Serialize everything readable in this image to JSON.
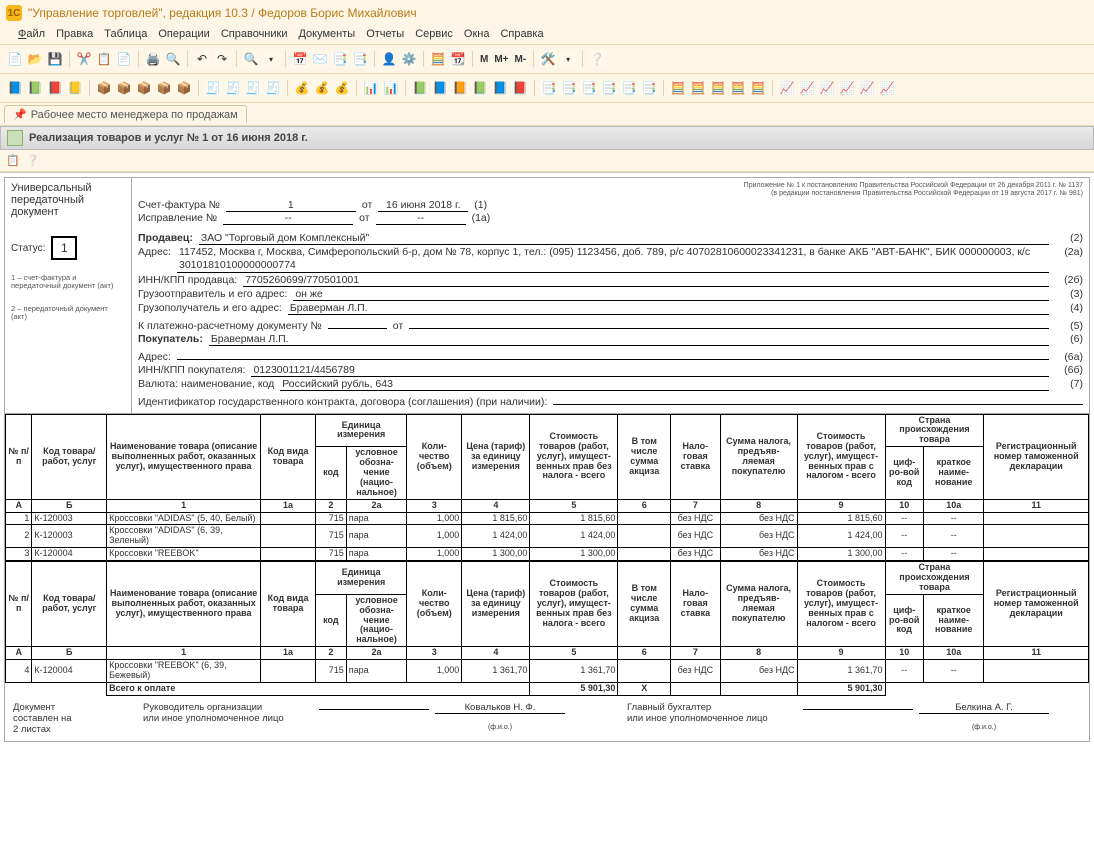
{
  "app": {
    "title": "\"Управление торговлей\", редакция 10.3 / Федоров Борис Михайлович"
  },
  "menu": {
    "file": "Файл",
    "edit": "Правка",
    "table": "Таблица",
    "ops": "Операции",
    "refs": "Справочники",
    "docs": "Документы",
    "reports": "Отчеты",
    "service": "Сервис",
    "windows": "Окна",
    "help": "Справка"
  },
  "toolbar2_labels": {
    "m": "M",
    "mplus": "M+",
    "mminus": "M-"
  },
  "tab": {
    "workspace": "Рабочее место менеджера по продажам"
  },
  "section": {
    "title": "Реализация товаров и услуг № 1 от 16 июня 2018 г."
  },
  "upd_left": {
    "line1": "Универсальный",
    "line2": "передаточный",
    "line3": "документ",
    "status_lbl": "Статус:",
    "status_val": "1",
    "foot1": "1 – счет-фактура и передаточный документ (акт)",
    "foot2": "2 – передаточный документ (акт)"
  },
  "reg_note": {
    "l1": "Приложение № 1 к постановлению Правительства Российской Федерации от 26 декабря 2011 г. № 1137",
    "l2": "(в редакции постановления Правительства Российской Федерации от 19 августа 2017 г. № 981)"
  },
  "invoice": {
    "sf_lbl": "Счет-фактура №",
    "sf_no": "1",
    "sf_ot": "от",
    "sf_date": "16 июня 2018 г.",
    "sf_code": "(1)",
    "isp_lbl": "Исправление №",
    "isp_no": "--",
    "isp_ot": "от",
    "isp_date": "--",
    "isp_code": "(1а)"
  },
  "fields": {
    "seller_lbl": "Продавец:",
    "seller_val": "ЗАО \"Торговый дом Комплексный\"",
    "seller_code": "(2)",
    "addr_lbl": "Адрес:",
    "addr_val": "117452, Москва г, Москва, Симферопольский б-р, дом № 78, корпус 1, тел.: (095) 1123456, доб. 789, р/с 40702810600023341231, в банке АКБ \"АВТ-БАНК\", БИК 000000003, к/с 30101810100000000774",
    "addr_code": "(2а)",
    "inn_s_lbl": "ИНН/КПП продавца:",
    "inn_s_val": "7705260699/770501001",
    "inn_s_code": "(2б)",
    "ship_from_lbl": "Грузоотправитель и его адрес:",
    "ship_from_val": "он же",
    "ship_from_code": "(3)",
    "ship_to_lbl": "Грузополучатель и его адрес:",
    "ship_to_val": "Браверман Л.П.",
    "ship_to_code": "(4)",
    "paydoc_lbl": "К платежно-расчетному документу №",
    "paydoc_val": "",
    "paydoc_ot": "от",
    "paydoc_code": "(5)",
    "buyer_lbl": "Покупатель:",
    "buyer_val": "Браверман Л.П.",
    "buyer_code": "(6)",
    "baddr_lbl": "Адрес:",
    "baddr_val": "",
    "baddr_code": "(6а)",
    "inn_b_lbl": "ИНН/КПП покупателя:",
    "inn_b_val": "0123001121/4456789",
    "inn_b_code": "(6б)",
    "curr_lbl": "Валюта: наименование, код",
    "curr_val": "Российский рубль, 643",
    "curr_code": "(7)",
    "gov_lbl": "Идентификатор государственного контракта, договора (соглашения) (при наличии):"
  },
  "thead": {
    "c1": "№ п/п",
    "c2": "Код товара/ работ, услуг",
    "c3": "Наименование товара (описание выполненных работ, оказанных услуг), имущественного права",
    "c4": "Код вида товара",
    "c5_top": "Единица измерения",
    "c5a": "код",
    "c5b": "условное обозна-чение (нацио-нальное)",
    "c6": "Коли-чество (объем)",
    "c7": "Цена (тариф) за единицу измерения",
    "c8": "Стоимость товаров (работ, услуг), имущест-венных прав без налога - всего",
    "c9": "В том числе сумма акциза",
    "c10": "Нало-говая ставка",
    "c11": "Сумма налога, предъяв-ляемая покупателю",
    "c12": "Стоимость товаров (работ, услуг), имущест-венных прав с налогом - всего",
    "c13_top": "Страна происхождения товара",
    "c13a": "циф-ро-вой код",
    "c13b": "краткое наиме-нование",
    "c14": "Регистрационный номер таможенной декларации",
    "rA": "А",
    "rB": "Б",
    "r1": "1",
    "r1a": "1а",
    "r2": "2",
    "r2a": "2а",
    "r3": "3",
    "r4": "4",
    "r5": "5",
    "r6": "6",
    "r7": "7",
    "r8": "8",
    "r9": "9",
    "r10": "10",
    "r10a": "10а",
    "r11": "11"
  },
  "rows1": [
    {
      "n": "1",
      "code": "К-120003",
      "name": "Кроссовки \"ADIDAS\" (5, 40, Белый)",
      "kind": "",
      "ucode": "715",
      "uname": "пара",
      "qty": "1,000",
      "price": "1 815,60",
      "sum_wo": "1 815,60",
      "excise": "",
      "rate": "без НДС",
      "tax": "без НДС",
      "sum_w": "1 815,60",
      "cc": "--",
      "cn": "--",
      "decl": ""
    },
    {
      "n": "2",
      "code": "К-120003",
      "name": "Кроссовки \"ADIDAS\" (6, 39, Зеленый)",
      "kind": "",
      "ucode": "715",
      "uname": "пара",
      "qty": "1,000",
      "price": "1 424,00",
      "sum_wo": "1 424,00",
      "excise": "",
      "rate": "без НДС",
      "tax": "без НДС",
      "sum_w": "1 424,00",
      "cc": "--",
      "cn": "--",
      "decl": ""
    },
    {
      "n": "3",
      "code": "К-120004",
      "name": "Кроссовки \"REEBOK\"",
      "kind": "",
      "ucode": "715",
      "uname": "пара",
      "qty": "1,000",
      "price": "1 300,00",
      "sum_wo": "1 300,00",
      "excise": "",
      "rate": "без НДС",
      "tax": "без НДС",
      "sum_w": "1 300,00",
      "cc": "--",
      "cn": "--",
      "decl": ""
    }
  ],
  "rows2": [
    {
      "n": "4",
      "code": "К-120004",
      "name": "Кроссовки \"REEBOK\" (6, 39, Бежевый)",
      "kind": "",
      "ucode": "715",
      "uname": "пара",
      "qty": "1,000",
      "price": "1 361,70",
      "sum_wo": "1 361,70",
      "excise": "",
      "rate": "без НДС",
      "tax": "без НДС",
      "sum_w": "1 361,70",
      "cc": "--",
      "cn": "--",
      "decl": ""
    }
  ],
  "totals": {
    "lbl": "Всего к оплате",
    "sum_wo": "5 901,30",
    "excise": "Х",
    "tax": "",
    "sum_w": "5 901,30"
  },
  "sign": {
    "pages_lbl1": "Документ",
    "pages_lbl2": "составлен на",
    "pages_lbl3": "2 листах",
    "head_lbl1": "Руководитель организации",
    "head_lbl2": "или иное уполномоченное лицо",
    "head_name": "Ковальков  Н. Ф.",
    "acc_lbl1": "Главный бухгалтер",
    "acc_lbl2": "или иное уполномоченное лицо",
    "acc_name": "Белкина А. Г.",
    "fio": "(ф.и.о.)"
  }
}
